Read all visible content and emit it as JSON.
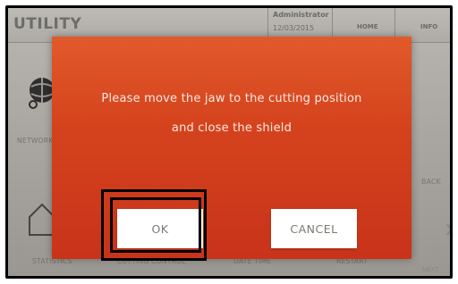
{
  "app": {
    "title": "UTILITY"
  },
  "header": {
    "user": "Administrator",
    "date": "12/03/2015",
    "nav": {
      "home": "HOME",
      "info": "INFO"
    }
  },
  "background": {
    "tiles": [
      {
        "label": "NETWORK",
        "icon": "network-globe-icon"
      },
      {
        "label": "STATISTICS",
        "icon": "home-icon"
      },
      {
        "label": "CUTTING CONTROL",
        "icon": ""
      },
      {
        "label": "DATE TIME",
        "icon": ""
      },
      {
        "label": "RESTART",
        "icon": ""
      }
    ],
    "side": {
      "back": "BACK",
      "next": "NEXT",
      "arrow_icon": "chevron-right-icon"
    }
  },
  "dialog": {
    "line1": "Please move the jaw to the cutting position",
    "line2": "and close the shield",
    "ok_label": "OK",
    "cancel_label": "CANCEL"
  },
  "colors": {
    "dialog_top": "#e15a2b",
    "dialog_bottom": "#c8331a",
    "button_bg": "#ffffff",
    "button_text": "#7d7873",
    "highlight": "#000000"
  }
}
